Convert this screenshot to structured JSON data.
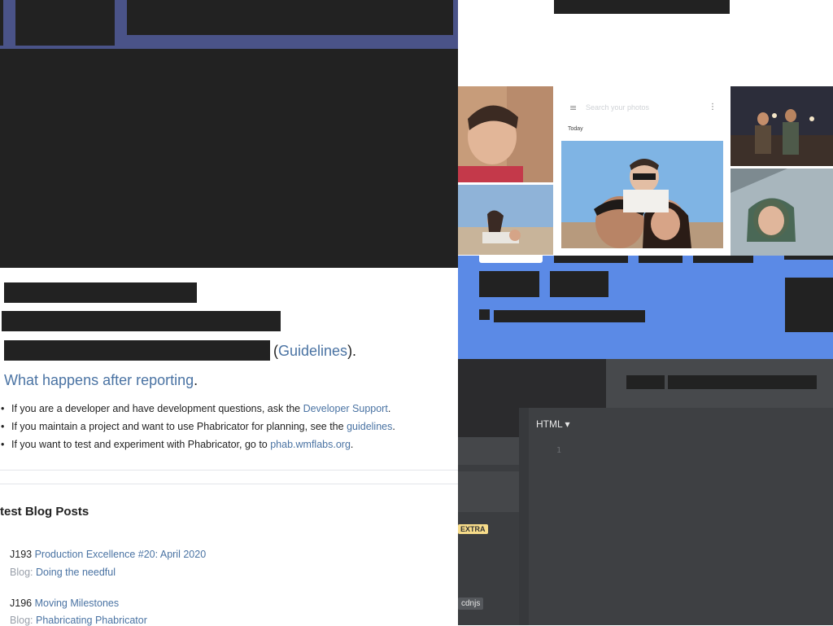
{
  "phabricator": {
    "guidelines_link": "Guidelines",
    "paren_open": "(",
    "paren_close": ").",
    "what_happens_link": "What happens after reporting",
    "what_happens_period": ".",
    "bullets": [
      {
        "prefix": "If you are a developer and have development questions, ask the ",
        "link": "Developer Support",
        "suffix": "."
      },
      {
        "prefix": "If you maintain a project and want to use Phabricator for planning, see the ",
        "link": "guidelines",
        "suffix": "."
      },
      {
        "prefix": "If you want to test and experiment with Phabricator, go to ",
        "link": "phab.wmflabs.org",
        "suffix": "."
      }
    ],
    "blog_heading": "test Blog Posts",
    "blog_posts": [
      {
        "id": "J193",
        "title": "Production Excellence #20: April 2020",
        "blog_label": "Blog:",
        "blog_name": "Doing the needful"
      },
      {
        "id": "J196",
        "title": "Moving Milestones",
        "blog_label": "Blog:",
        "blog_name": "Phabricating Phabricator"
      }
    ]
  },
  "photos_app": {
    "menu_icon": "hamburger-menu-icon",
    "search_placeholder": "Search your photos",
    "more_icon": "vertical-dots-icon",
    "section_label": "Today"
  },
  "editor": {
    "language_label": "HTML ▾",
    "line_number": "1",
    "extra_badge": "EXTRA",
    "cdnjs_badge": "cdnjs"
  },
  "colors": {
    "top_bar": "#4a5388",
    "link": "#4a73a3",
    "blue_panel": "#5b8ae6",
    "dark_panel": "#3b3d40"
  }
}
